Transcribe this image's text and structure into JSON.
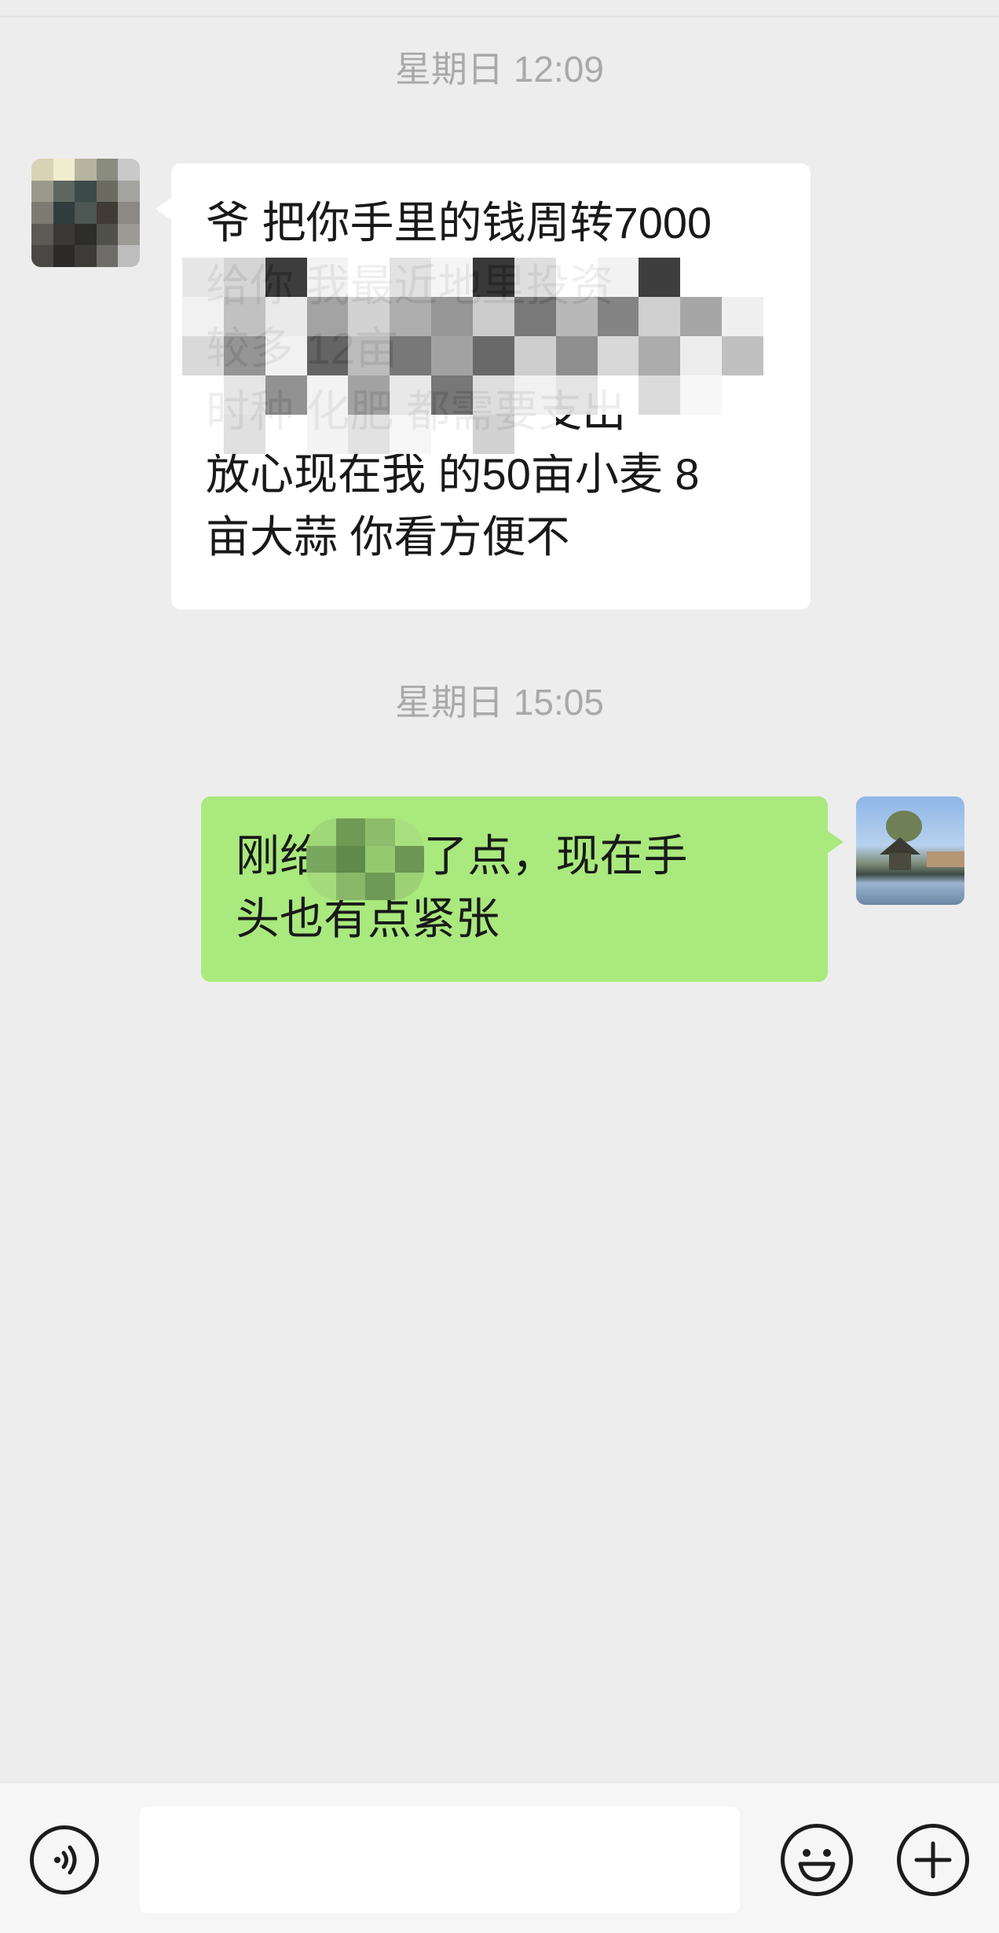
{
  "chat": {
    "messages": [
      {
        "timestamp": "星期日 12:09",
        "sender": "contact",
        "lines": [
          "爷 把你手里的钱周转7000",
          "给你 我最近地里投资",
          "较多 12亩",
          "时种 化肥 都需要支出",
          "放心现在我 的50亩小麦 8",
          "亩大蒜 你看方便不"
        ]
      },
      {
        "timestamp": "星期日 15:05",
        "sender": "me",
        "lines": [
          "刚给 准备了点，现在手",
          "头也有点紧张"
        ]
      }
    ]
  },
  "input_bar": {
    "text_value": "",
    "icons": [
      "voice-icon",
      "emoji-icon",
      "plus-icon"
    ]
  },
  "colors": {
    "background": "#ededed",
    "incoming_bubble": "#ffffff",
    "outgoing_bubble": "#a9e97d",
    "timestamp_text": "#a9a9a9"
  }
}
